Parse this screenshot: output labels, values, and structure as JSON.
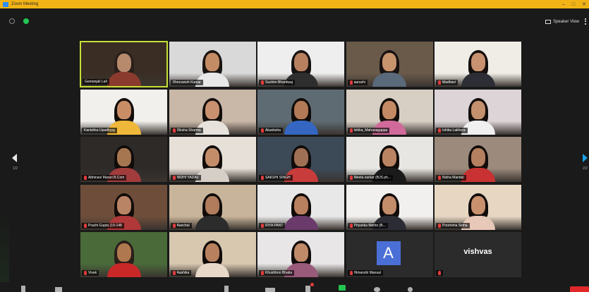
{
  "window": {
    "title": "Zoom Meeting",
    "controls": [
      "–",
      "□",
      "✕"
    ]
  },
  "topbar": {
    "speaker_view_label": "Speaker View"
  },
  "pagination": {
    "left": "1/2",
    "right": "2/2"
  },
  "participants": [
    {
      "name": "Geetanjali Lall",
      "muted": false,
      "active": true
    },
    {
      "name": "Dhruvansh Kumar",
      "muted": false
    },
    {
      "name": "Sushim Bhardwaj",
      "muted": true
    },
    {
      "name": "aarushi",
      "muted": true
    },
    {
      "name": "Madhavi",
      "muted": true
    },
    {
      "name": "Kanishka Upadhyay",
      "muted": false
    },
    {
      "name": "Diksha Sharma",
      "muted": true
    },
    {
      "name": "Akanksha",
      "muted": true
    },
    {
      "name": "Ishika_Mahanagappa",
      "muted": true
    },
    {
      "name": "Ishika Lakhera",
      "muted": true
    },
    {
      "name": "Abhinavi Murari B.Com",
      "muted": true
    },
    {
      "name": "NIDHI YADAV",
      "muted": true
    },
    {
      "name": "SAKSHI SINGH",
      "muted": true
    },
    {
      "name": "Meeta sarkar (BJS ph...",
      "muted": true
    },
    {
      "name": "Nisha Mandal",
      "muted": true
    },
    {
      "name": "Prachi Gupta (19-148",
      "muted": true
    },
    {
      "name": "Aanchal",
      "muted": true
    },
    {
      "name": "RIYA PANT",
      "muted": true
    },
    {
      "name": "Priyanka Mehto (B...",
      "muted": true
    },
    {
      "name": "Poornima Sinha",
      "muted": true
    },
    {
      "name": "Vivek",
      "muted": true
    },
    {
      "name": "Aashika",
      "muted": true
    },
    {
      "name": "Khushboo Bhatia",
      "muted": true
    },
    {
      "name": "Himanshi Mansal",
      "muted": true,
      "avatar_letter": "A"
    },
    {
      "name": "",
      "muted": true,
      "display_name": "vishvas"
    }
  ],
  "colors": {
    "titlebar": "#f2b316",
    "active_speaker": "#c7e036",
    "muted": "#e23b3b",
    "end": "#e02828",
    "next_arrow": "#1ba0e8"
  }
}
